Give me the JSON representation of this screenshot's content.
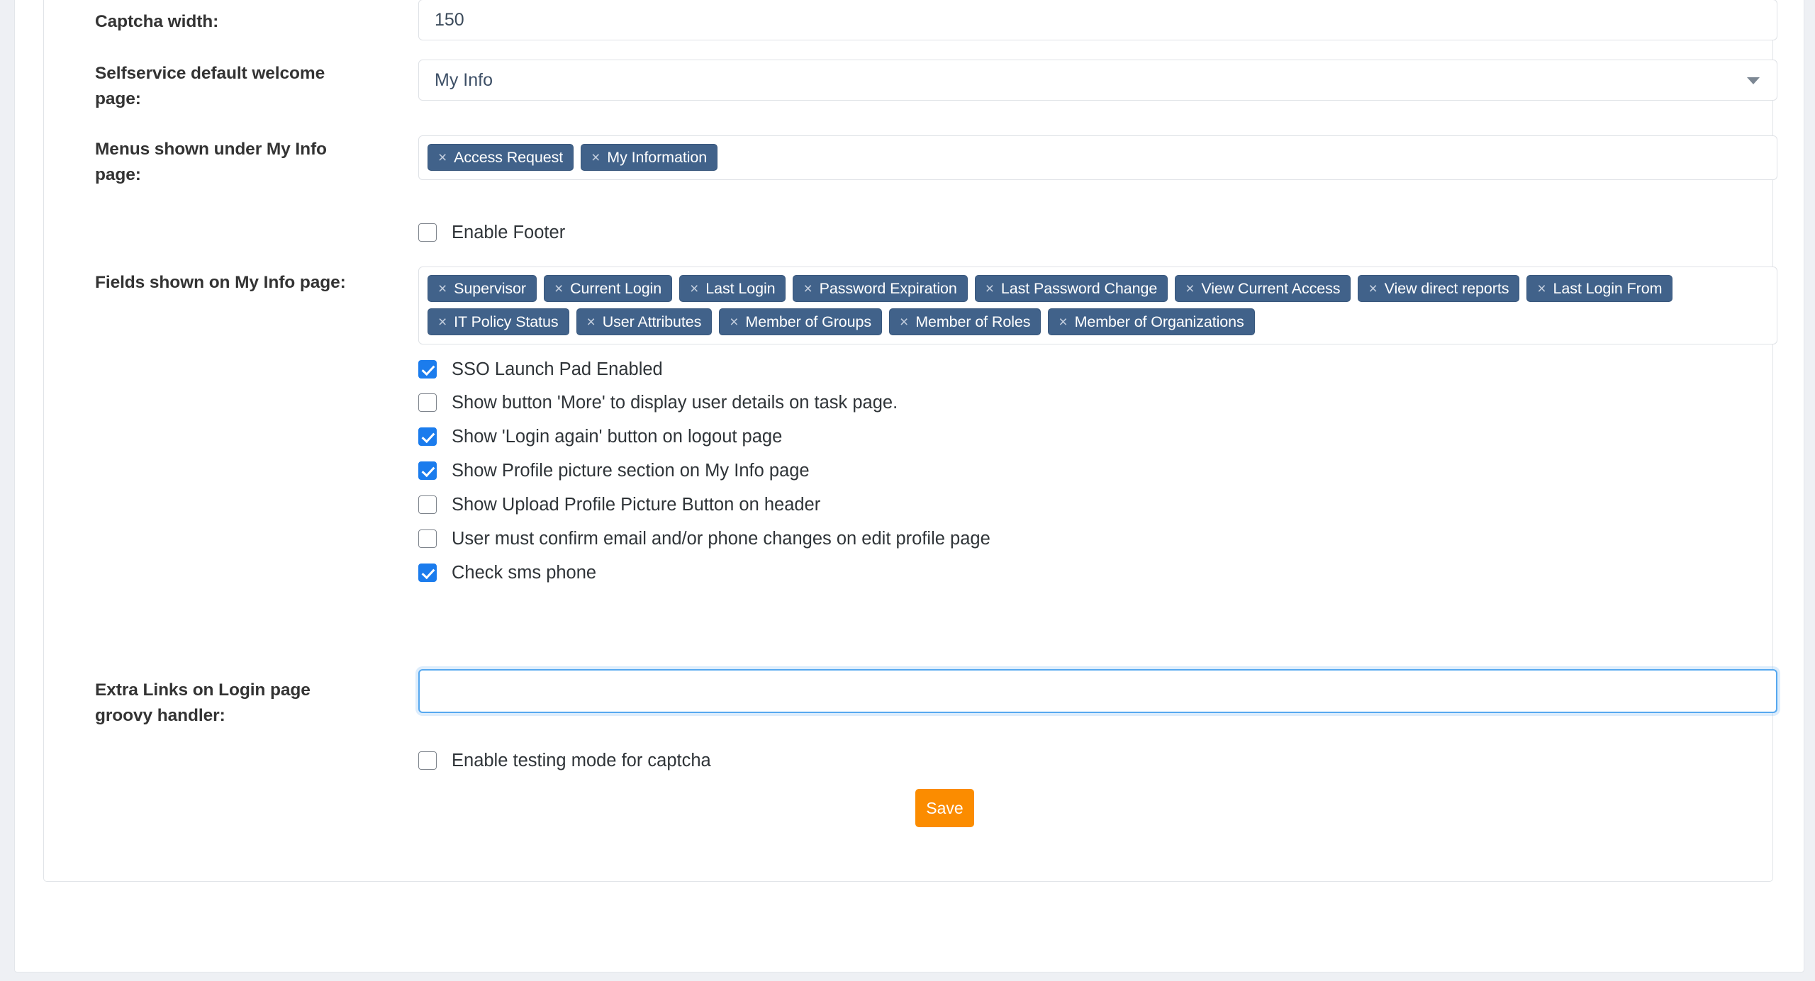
{
  "form": {
    "captcha_width": {
      "label": "Captcha width:",
      "value": "150",
      "placeholder": ""
    },
    "selfservice_welcome_page": {
      "label": "Selfservice default welcome page:",
      "selected": "My Info"
    },
    "menus_under_my_info": {
      "label": "Menus shown under My Info page:",
      "tags": [
        "Access Request",
        "My Information"
      ]
    },
    "enable_footer": {
      "label": "Enable Footer",
      "checked": false
    },
    "fields_on_my_info": {
      "label": "Fields shown on My Info page:",
      "tags": [
        "Supervisor",
        "Current Login",
        "Last Login",
        "Password Expiration",
        "Last Password Change",
        "View Current Access",
        "View direct reports",
        "Last Login From",
        "IT Policy Status",
        "User Attributes",
        "Member of Groups",
        "Member of Roles",
        "Member of Organizations"
      ]
    },
    "toggles": [
      {
        "label": "SSO Launch Pad Enabled",
        "checked": true
      },
      {
        "label": "Show button 'More' to display user details on task page.",
        "checked": false
      },
      {
        "label": "Show 'Login again' button on logout page",
        "checked": true
      },
      {
        "label": "Show Profile picture section on My Info page",
        "checked": true
      },
      {
        "label": "Show Upload Profile Picture Button on header",
        "checked": false
      },
      {
        "label": "User must confirm email and/or phone changes on edit profile page",
        "checked": false
      },
      {
        "label": "Check sms phone",
        "checked": true
      }
    ],
    "extra_links": {
      "label": "Extra Links on Login page groovy handler:",
      "value": "",
      "placeholder": ""
    },
    "enable_testing_captcha": {
      "label": "Enable testing mode for captcha",
      "checked": false
    },
    "save_button": {
      "label": "Save"
    }
  },
  "icons": {
    "tag_remove": "×",
    "dropdown_arrow": "chevron-down-icon"
  },
  "colors": {
    "tag_background": "#41628a",
    "checkbox_checked": "#1b7ced",
    "save_button": "#fb8c00",
    "focus_border": "#56a8ef"
  }
}
